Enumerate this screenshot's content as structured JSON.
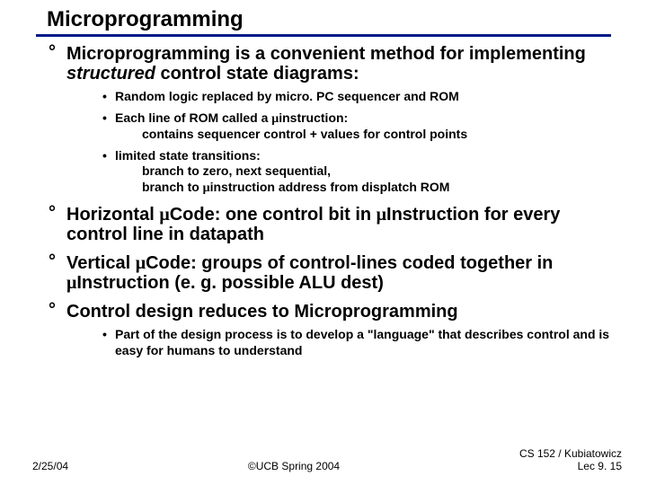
{
  "title": "Microprogramming",
  "points": {
    "p1": {
      "pre": "Microprogramming is a convenient method for implementing ",
      "ital": "structured",
      "post": " control state diagrams:"
    },
    "sub1": {
      "a": "Random logic replaced by micro. PC sequencer and ROM",
      "b_line1": "Each line of ROM called a ",
      "b_line1_post": "instruction:",
      "b_line2": "contains sequencer control + values for control points",
      "c_line1": "limited state transitions:",
      "c_line2": "branch to zero, next sequential,",
      "c_line3_pre": "branch to ",
      "c_line3_post": "instruction address from displatch ROM"
    },
    "p2_a": "Horizontal  ",
    "p2_b": "Code: one control bit in ",
    "p2_c": "Instruction for every control line in datapath",
    "p3_a": "Vertical ",
    "p3_b": "Code: groups of control-lines coded together in ",
    "p3_c": "Instruction (e. g. possible ALU dest)",
    "p4": "Control design reduces to Microprogramming",
    "sub4": "Part of the design process is to develop a \"language\" that describes control and is easy for humans to understand"
  },
  "mu": "μ",
  "footer": {
    "left": "2/25/04",
    "center": "©UCB Spring 2004",
    "right1": "CS 152 / Kubiatowicz",
    "right2": "Lec 9. 15"
  }
}
